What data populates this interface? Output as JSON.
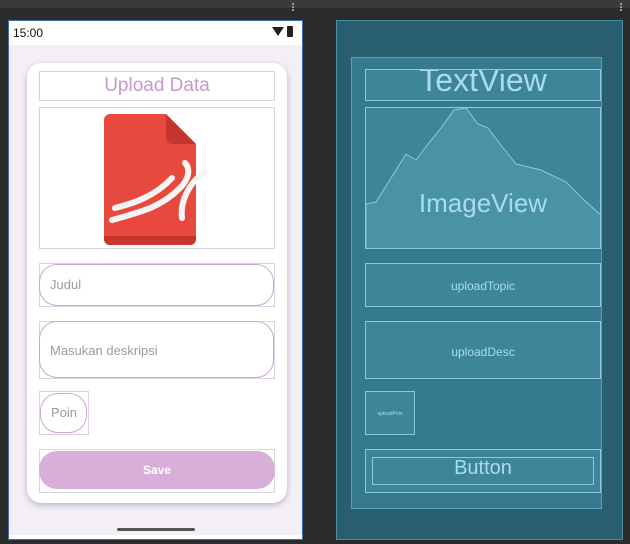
{
  "status_bar": {
    "time": "15:00"
  },
  "phone": {
    "title": "Upload Data",
    "fields": {
      "judul_placeholder": "Judul",
      "deskripsi_placeholder": "Masukan deskripsi",
      "poin_placeholder": "Poin"
    },
    "save_label": "Save"
  },
  "blueprint": {
    "textview_label": "TextView",
    "imageview_label": "ImageView",
    "upload_topic": "uploadTopic",
    "upload_desc": "uploadDesc",
    "upload_poin": "uploadPoin",
    "button_label": "Button"
  },
  "colors": {
    "accent": "#d9aed9",
    "title_color": "#c997cf",
    "pdf_red": "#e8493f",
    "blueprint_bg": "#2a5f72"
  }
}
